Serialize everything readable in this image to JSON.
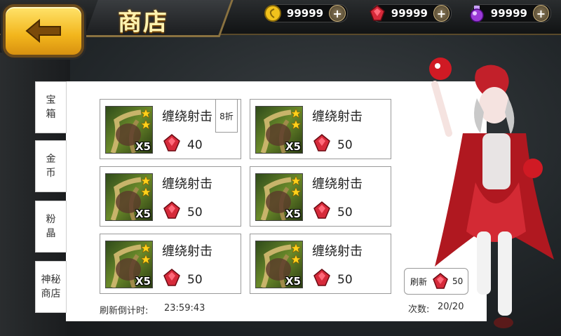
{
  "header": {
    "title": "商店",
    "resources": [
      {
        "name": "gold",
        "value": "99999",
        "color": "#f2c21c"
      },
      {
        "name": "ruby",
        "value": "99999",
        "color": "#d62a3a"
      },
      {
        "name": "crystal",
        "value": "99999",
        "color": "#9a3ad6"
      }
    ]
  },
  "tabs": [
    {
      "label1": "宝",
      "label2": "箱"
    },
    {
      "label1": "金",
      "label2": "币"
    },
    {
      "label1": "粉",
      "label2": "晶"
    },
    {
      "label1": "神秘",
      "label2": "商店"
    }
  ],
  "items": [
    {
      "name": "缠绕射击",
      "qty": "X5",
      "price": "40"
    },
    {
      "name": "缠绕射击",
      "qty": "X5",
      "price": "50"
    },
    {
      "name": "缠绕射击",
      "qty": "X5",
      "price": "50"
    },
    {
      "name": "缠绕射击",
      "qty": "X5",
      "price": "50"
    },
    {
      "name": "缠绕射击",
      "qty": "X5",
      "price": "50"
    },
    {
      "name": "缠绕射击",
      "qty": "X5",
      "price": "50"
    }
  ],
  "discount_label": "8折",
  "footer": {
    "countdown_label": "刷新倒计时:",
    "countdown_value": "23:59:43",
    "count_label": "次数:",
    "count_value": "20/20",
    "refresh_label": "刷新",
    "refresh_cost": "50"
  }
}
